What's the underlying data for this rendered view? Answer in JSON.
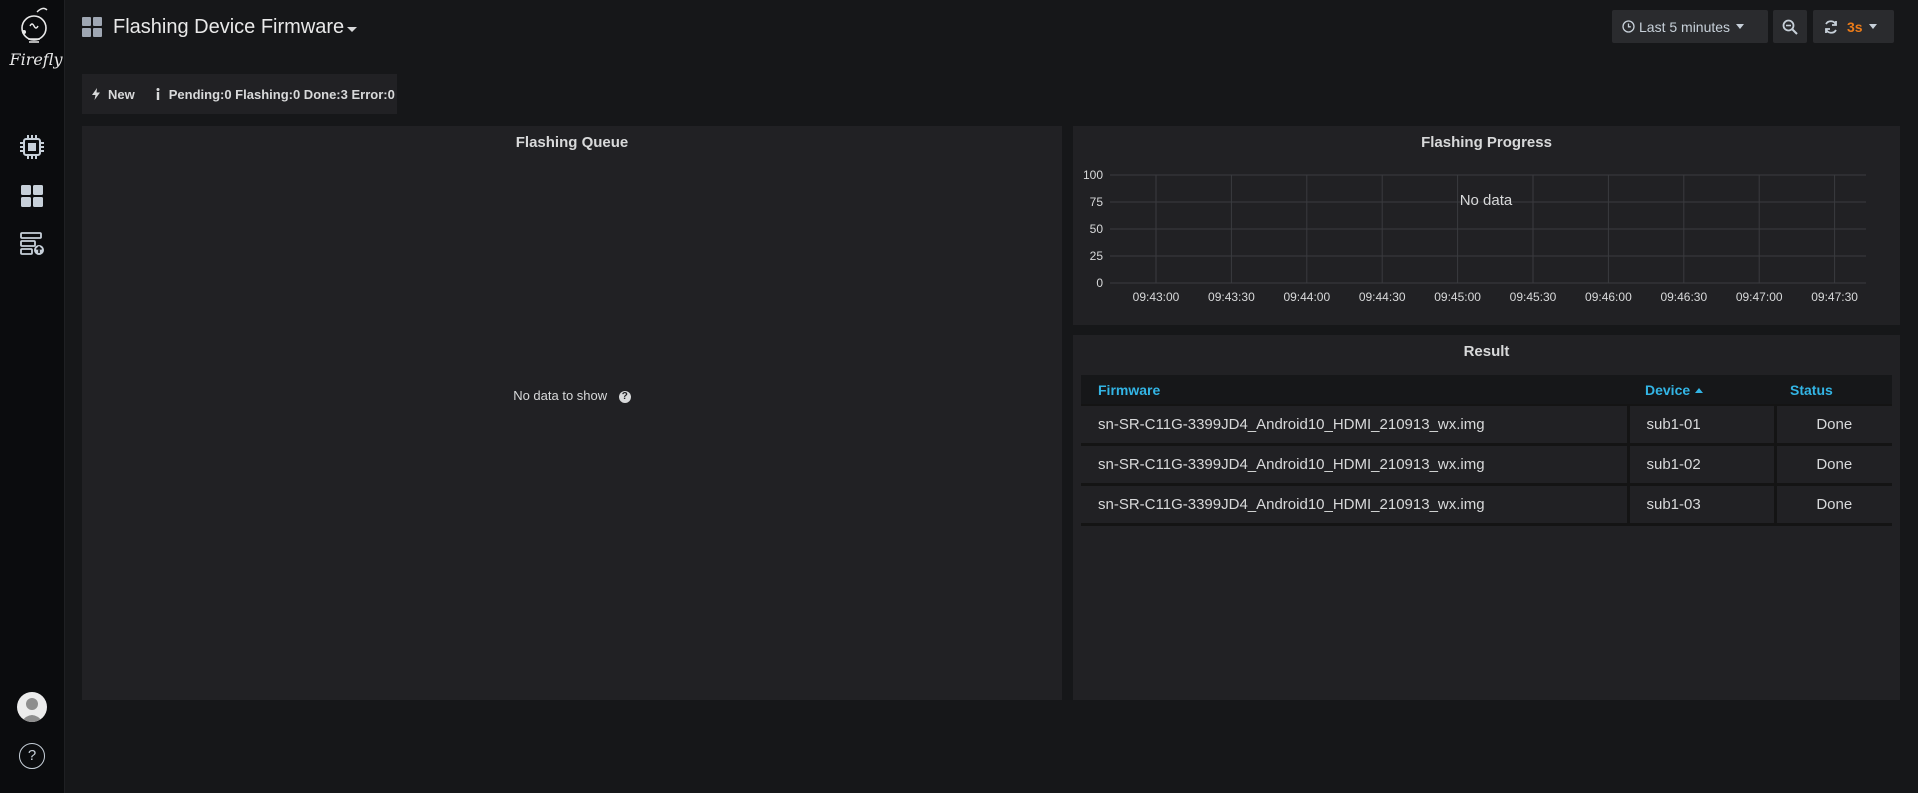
{
  "sidebar": {
    "logo_text": "Firefly",
    "items": [
      {
        "name": "chip-icon"
      },
      {
        "name": "dashboards-icon"
      },
      {
        "name": "server-upload-icon"
      }
    ]
  },
  "header": {
    "title": "Flashing Device Firmware",
    "time_range": "Last 5 minutes",
    "refresh_rate": "3s"
  },
  "submenu": {
    "new_label": "New",
    "status_text": "Pending:0 Flashing:0 Done:3 Error:0"
  },
  "queue_panel": {
    "title": "Flashing Queue",
    "empty_text": "No data to show",
    "help_glyph": "?"
  },
  "progress_panel": {
    "title": "Flashing Progress",
    "no_data": "No data"
  },
  "chart_data": {
    "type": "line",
    "title": "Flashing Progress",
    "xlabel": "",
    "ylabel": "",
    "ylim": [
      0,
      100
    ],
    "yticks": [
      "0",
      "25",
      "50",
      "75",
      "100"
    ],
    "xticks": [
      "09:43:00",
      "09:43:30",
      "09:44:00",
      "09:44:30",
      "09:45:00",
      "09:45:30",
      "09:46:00",
      "09:46:30",
      "09:47:00",
      "09:47:30"
    ],
    "grid": true,
    "series": []
  },
  "result_panel": {
    "title": "Result",
    "columns": [
      "Firmware",
      "Device",
      "Status"
    ],
    "rows": [
      [
        "sn-SR-C11G-3399JD4_Android10_HDMI_210913_wx.img",
        "sub1-01",
        "Done"
      ],
      [
        "sn-SR-C11G-3399JD4_Android10_HDMI_210913_wx.img",
        "sub1-02",
        "Done"
      ],
      [
        "sn-SR-C11G-3399JD4_Android10_HDMI_210913_wx.img",
        "sub1-03",
        "Done"
      ]
    ]
  },
  "colors": {
    "background": "#161719",
    "panel": "#212124",
    "link_blue": "#33b5e5",
    "refresh_orange": "#eb7b18"
  }
}
